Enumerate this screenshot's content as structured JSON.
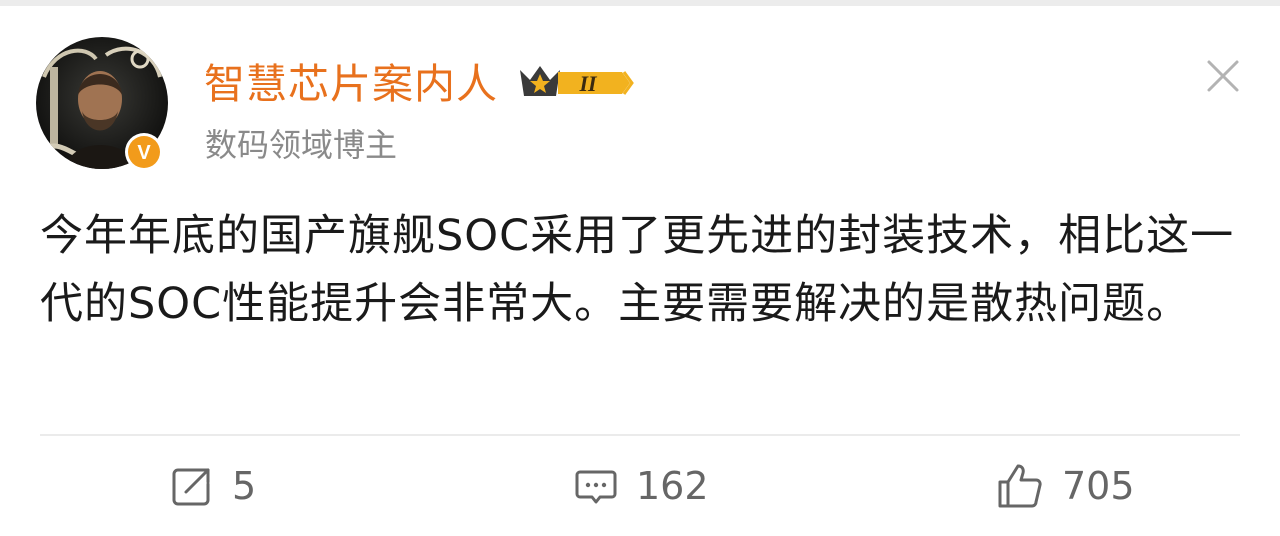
{
  "author": {
    "name": "智慧芯片案内人",
    "subtitle": "数码领域博主",
    "level_badge": "II",
    "verified": "V"
  },
  "post": {
    "text": "今年年底的国产旗舰SOC采用了更先进的封装技术，相比这一代的SOC性能提升会非常大。主要需要解决的是散热问题。"
  },
  "actions": {
    "repost_count": "5",
    "comment_count": "162",
    "like_count": "705"
  },
  "icons": {
    "close": "close-icon",
    "repost": "repost-icon",
    "comment": "comment-icon",
    "like": "thumbs-up-icon"
  },
  "colors": {
    "username": "#e8711d",
    "badge_gold": "#f2b21f",
    "verified_orange": "#f29b1b"
  }
}
